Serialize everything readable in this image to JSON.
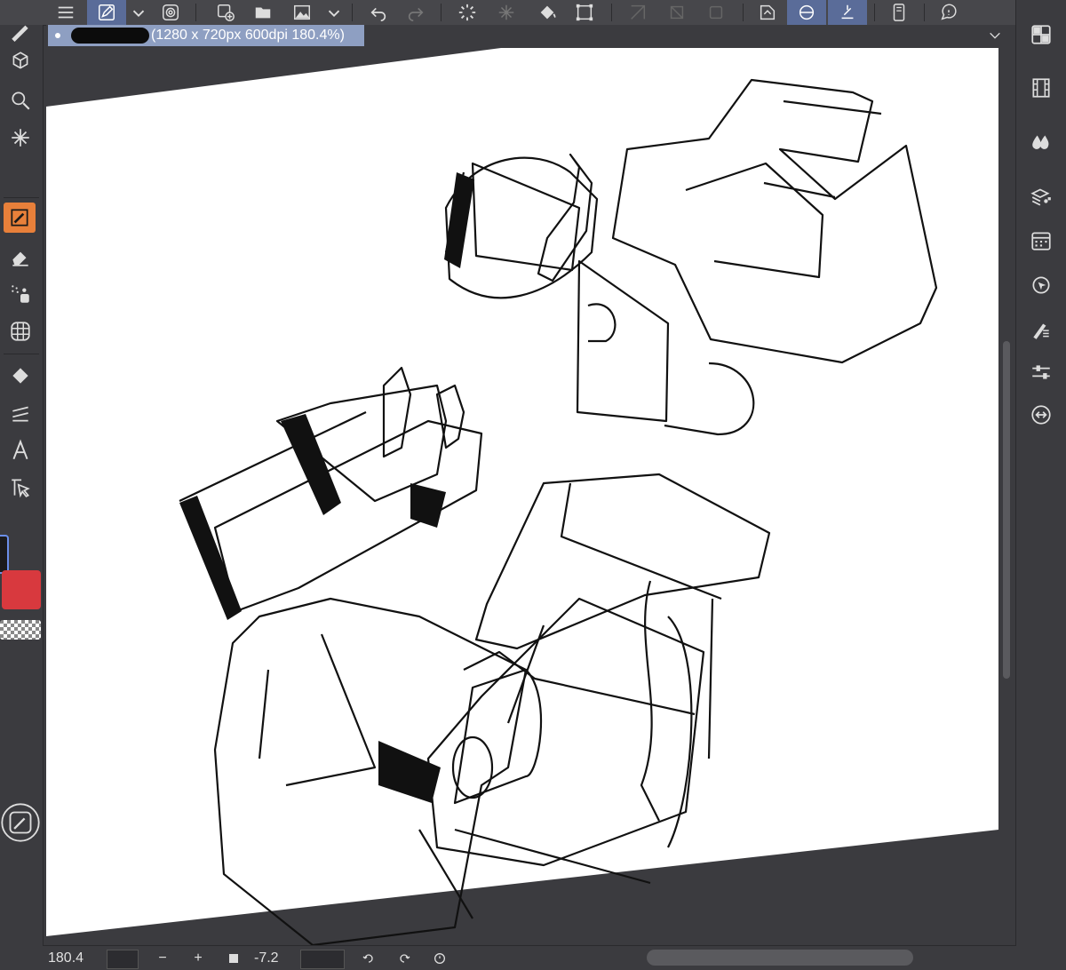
{
  "document_tab": {
    "info_label": "(1280 x 720px 600dpi 180.4%)"
  },
  "status_bar": {
    "zoom_value": "180.4",
    "zoom_out_label": "−",
    "zoom_in_label": "+",
    "rotation_value": "-7.2"
  },
  "colors": {
    "main_color": "#d8393e",
    "active_tab": "#8e9fc2",
    "selected_tool": "#e8803a",
    "toolbar_active": "#5a6c99"
  },
  "top_toolbar": {
    "items": [
      "menu-icon",
      "pen-edit-icon",
      "dropdown-icon",
      "spiral-icon",
      "new-canvas-icon",
      "open-folder-icon",
      "image-icon",
      "dropdown-icon",
      "undo-icon",
      "redo-icon",
      "loading-icon",
      "grid-fill-icon",
      "fill-icon",
      "select-all-icon",
      "ruler-icon",
      "transform-icon",
      "edit-icon",
      "layer-icon",
      "tool-property-icon",
      "phone-icon",
      "help-icon"
    ]
  },
  "left_toolbar": {
    "items": [
      "brush-icon",
      "3d-object-icon",
      "zoom-icon",
      "magic-wand-icon",
      "pencil-icon",
      "eraser-icon",
      "airbrush-icon",
      "grid-icon",
      "fill-icon",
      "layer-move-icon",
      "text-icon",
      "select-arrow-icon"
    ]
  },
  "right_panel": {
    "items": [
      "color-grid-icon",
      "film-icon",
      "droplets-icon",
      "layers-shapes-icon",
      "calendar-icon",
      "navigator-icon",
      "pen-settings-icon",
      "sliders-icon",
      "share-icon"
    ]
  }
}
